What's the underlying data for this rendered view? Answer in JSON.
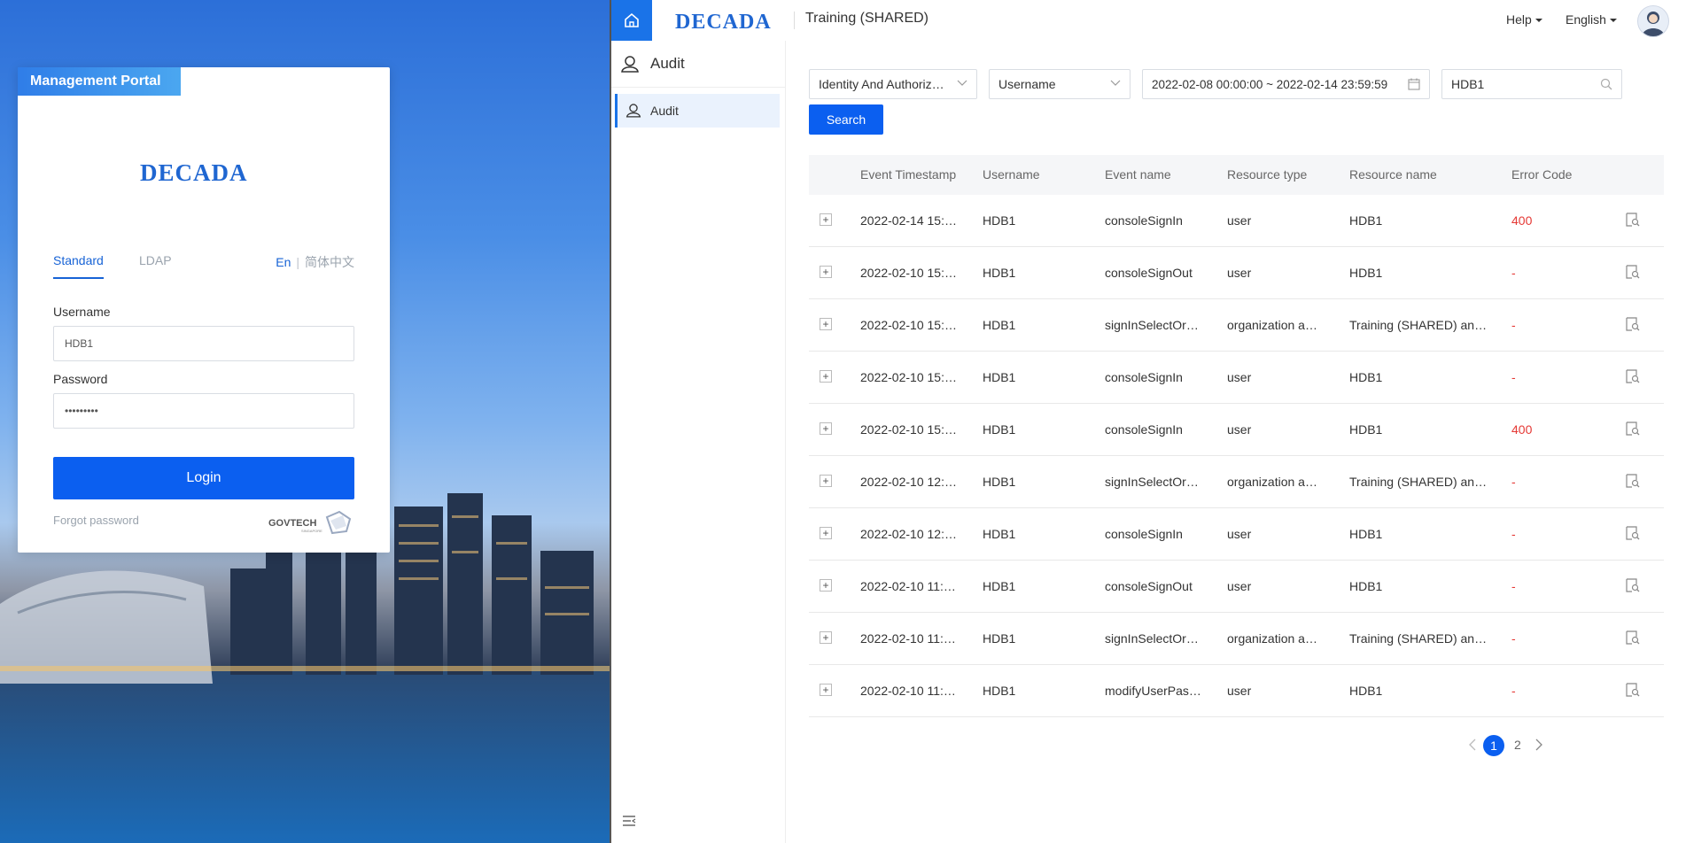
{
  "login": {
    "portal_tab": "Management Portal",
    "logo_text": "DECADA",
    "tabs": {
      "standard": "Standard",
      "ldap": "LDAP"
    },
    "lang": {
      "en": "En",
      "separator": "|",
      "cn": "简体中文"
    },
    "username_label": "Username",
    "username_value": "HDB1",
    "password_label": "Password",
    "password_value": "•••••••••",
    "login_button": "Login",
    "forgot_password": "Forgot password",
    "govtech_logo": "GOVTECH",
    "govtech_sub": "SINGAPORE"
  },
  "topbar": {
    "logo_text": "DECADA",
    "org_title": "Training (SHARED)",
    "help": "Help",
    "language": "English"
  },
  "sidebar": {
    "header": "Audit",
    "items": [
      {
        "label": "Audit",
        "active": true
      }
    ]
  },
  "filters": {
    "category": "Identity And Authorization",
    "field": "Username",
    "date_range": "2022-02-08 00:00:00 ~ 2022-02-14 23:59:59",
    "search_value": "HDB1",
    "search_button": "Search"
  },
  "table": {
    "columns": [
      "Event Timestamp",
      "Username",
      "Event name",
      "Resource type",
      "Resource name",
      "Error Code"
    ],
    "rows": [
      {
        "ts": "2022-02-14 15:…",
        "user": "HDB1",
        "event": "consoleSignIn",
        "rtype": "user",
        "rname": "HDB1",
        "err": "400"
      },
      {
        "ts": "2022-02-10 15:…",
        "user": "HDB1",
        "event": "consoleSignOut",
        "rtype": "user",
        "rname": "HDB1",
        "err": "-"
      },
      {
        "ts": "2022-02-10 15:…",
        "user": "HDB1",
        "event": "signInSelectOr…",
        "rtype": "organization a…",
        "rname": "Training (SHARED) an…",
        "err": "-"
      },
      {
        "ts": "2022-02-10 15:…",
        "user": "HDB1",
        "event": "consoleSignIn",
        "rtype": "user",
        "rname": "HDB1",
        "err": "-"
      },
      {
        "ts": "2022-02-10 15:…",
        "user": "HDB1",
        "event": "consoleSignIn",
        "rtype": "user",
        "rname": "HDB1",
        "err": "400"
      },
      {
        "ts": "2022-02-10 12:…",
        "user": "HDB1",
        "event": "signInSelectOr…",
        "rtype": "organization a…",
        "rname": "Training (SHARED) an…",
        "err": "-"
      },
      {
        "ts": "2022-02-10 12:…",
        "user": "HDB1",
        "event": "consoleSignIn",
        "rtype": "user",
        "rname": "HDB1",
        "err": "-"
      },
      {
        "ts": "2022-02-10 11:…",
        "user": "HDB1",
        "event": "consoleSignOut",
        "rtype": "user",
        "rname": "HDB1",
        "err": "-"
      },
      {
        "ts": "2022-02-10 11:…",
        "user": "HDB1",
        "event": "signInSelectOr…",
        "rtype": "organization a…",
        "rname": "Training (SHARED) an…",
        "err": "-"
      },
      {
        "ts": "2022-02-10 11:…",
        "user": "HDB1",
        "event": "modifyUserPas…",
        "rtype": "user",
        "rname": "HDB1",
        "err": "-"
      }
    ]
  },
  "pagination": {
    "current": "1",
    "pages": [
      "1",
      "2"
    ]
  },
  "icons": {
    "home": "home-icon",
    "search": "search-icon",
    "calendar": "calendar-icon",
    "chevron": "chevron-down-icon",
    "detail": "view-detail-icon",
    "collapse": "collapse-menu-icon",
    "user": "user-icon"
  },
  "colors": {
    "primary": "#0b5ff0",
    "error": "#e53935",
    "active_bg": "#eaf2fd"
  }
}
